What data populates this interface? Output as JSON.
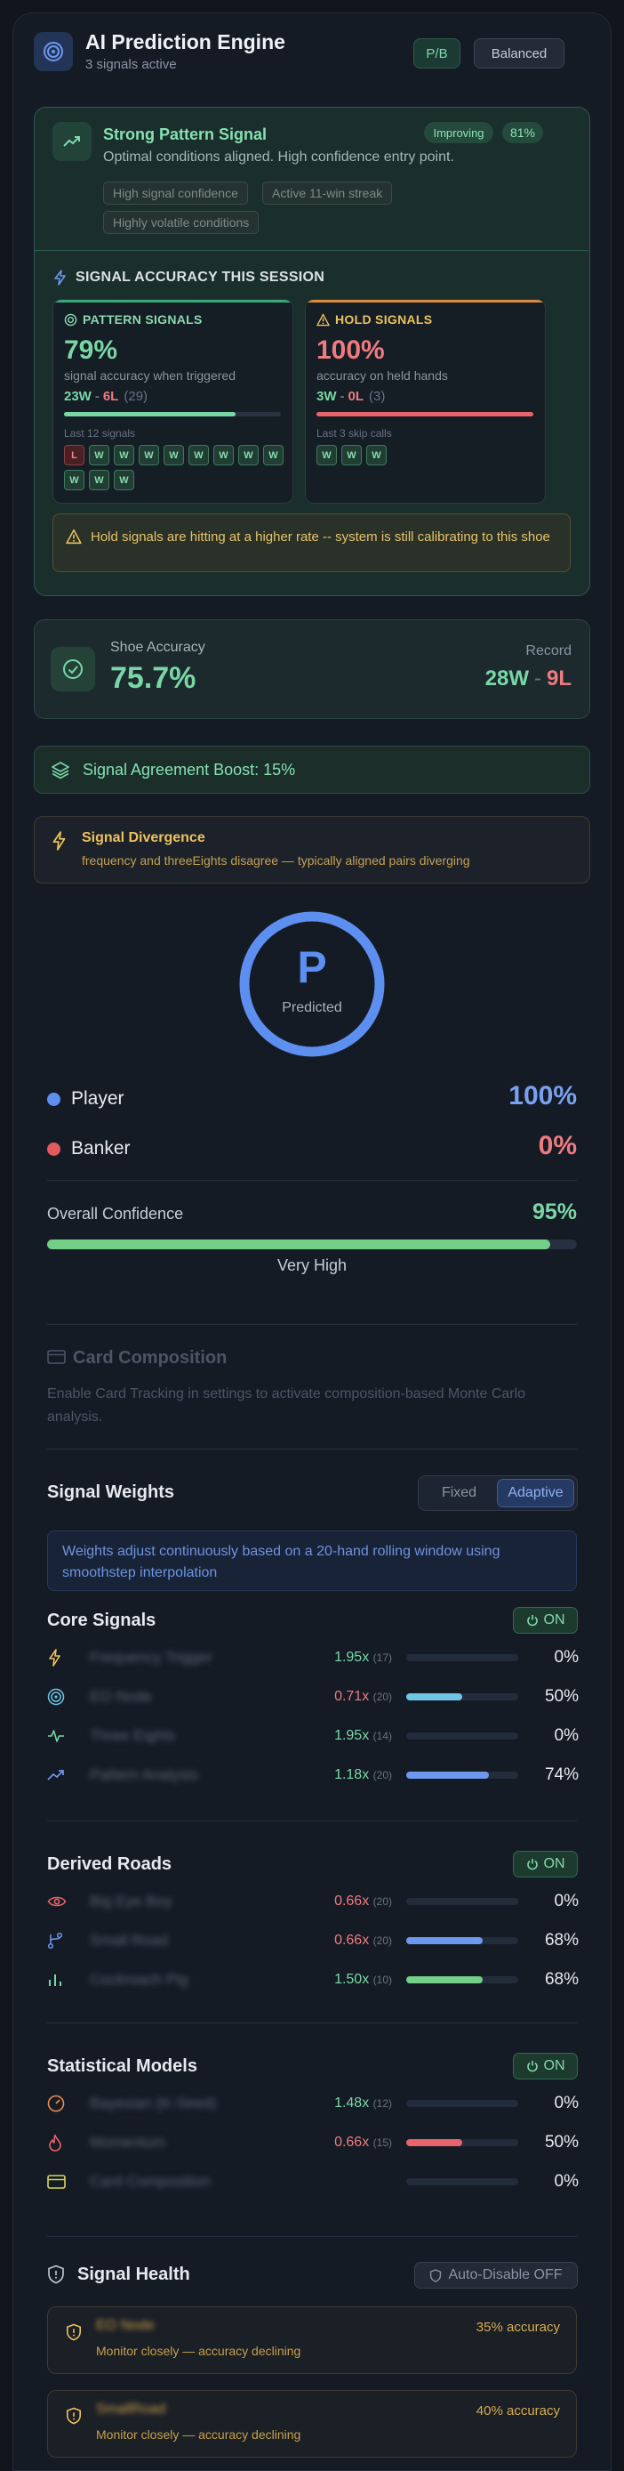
{
  "header": {
    "title": "AI Prediction Engine",
    "subtitle": "3 signals active",
    "mode_chip": "P/B",
    "profile_chip": "Balanced"
  },
  "strong_pattern": {
    "title": "Strong Pattern Signal",
    "description": "Optimal conditions aligned. High confidence entry point.",
    "trend_badge": "Improving",
    "confidence_badge": "81%",
    "tags": [
      "High signal confidence",
      "Active 11-win streak",
      "Highly volatile conditions"
    ]
  },
  "accuracy_session": {
    "heading": "SIGNAL ACCURACY THIS SESSION",
    "pattern": {
      "label": "PATTERN SIGNALS",
      "value": "79%",
      "caption": "signal accuracy when triggered",
      "wins": "23W",
      "sep": "-",
      "losses": "6L",
      "total": "(29)",
      "fill_fraction": 0.79,
      "last_label": "Last 12 signals",
      "history": [
        "L",
        "W",
        "W",
        "W",
        "W",
        "W",
        "W",
        "W",
        "W",
        "W",
        "W",
        "W"
      ]
    },
    "hold": {
      "label": "HOLD SIGNALS",
      "value": "100%",
      "caption": "accuracy on held hands",
      "wins": "3W",
      "sep": "-",
      "losses": "0L",
      "total": "(3)",
      "fill_fraction": 1.0,
      "last_label": "Last 3 skip calls",
      "history": [
        "W",
        "W",
        "W"
      ]
    },
    "warning": "Hold signals are hitting at a higher rate -- system is still calibrating to this shoe"
  },
  "shoe": {
    "label": "Shoe Accuracy",
    "value": "75.7%",
    "record_label": "Record",
    "record_wins": "28W",
    "record_sep": "-",
    "record_losses": "9L"
  },
  "boost": {
    "text": "Signal Agreement Boost: 15%"
  },
  "divergence": {
    "title": "Signal Divergence",
    "description": "frequency and threeEights disagree — typically aligned pairs diverging"
  },
  "prediction": {
    "letter": "P",
    "label": "Predicted",
    "player_label": "Player",
    "player_pct": "100%",
    "banker_label": "Banker",
    "banker_pct": "0%",
    "confidence_label": "Overall Confidence",
    "confidence_value": "95%",
    "confidence_fraction": 0.95,
    "confidence_text": "Very High"
  },
  "card_composition": {
    "title": "Card Composition",
    "description": "Enable Card Tracking in settings to activate composition-based Monte Carlo analysis."
  },
  "weights": {
    "title": "Signal Weights",
    "modes": [
      "Fixed",
      "Adaptive"
    ],
    "active_mode": "Adaptive",
    "info": "Weights adjust continuously based on a 20-hand rolling window using smoothstep interpolation"
  },
  "groups": [
    {
      "title": "Core Signals",
      "status": "ON",
      "rows": [
        {
          "icon": "lightning-icon",
          "name": "Frequency Trigger",
          "mult": "1.95x",
          "n": "(17)",
          "tone": "green",
          "fill": 0.0,
          "pct": "0%"
        },
        {
          "icon": "target-icon",
          "name": "EO Node",
          "mult": "0.71x",
          "n": "(20)",
          "tone": "red",
          "fill": 0.5,
          "pct": "50%",
          "bar": "cyan"
        },
        {
          "icon": "pulse-icon",
          "name": "Three Eights",
          "mult": "1.95x",
          "n": "(14)",
          "tone": "green",
          "fill": 0.0,
          "pct": "0%"
        },
        {
          "icon": "trend-icon",
          "name": "Pattern Analysis",
          "mult": "1.18x",
          "n": "(20)",
          "tone": "green",
          "fill": 0.74,
          "pct": "74%",
          "bar": "blue"
        }
      ]
    },
    {
      "title": "Derived Roads",
      "status": "ON",
      "rows": [
        {
          "icon": "eye-icon",
          "name": "Big Eye Boy",
          "mult": "0.66x",
          "n": "(20)",
          "tone": "red",
          "fill": 0.0,
          "pct": "0%"
        },
        {
          "icon": "branch-icon",
          "name": "Small Road",
          "mult": "0.66x",
          "n": "(20)",
          "tone": "red",
          "fill": 0.68,
          "pct": "68%",
          "bar": "blue"
        },
        {
          "icon": "bars-icon",
          "name": "Cockroach Pig",
          "mult": "1.50x",
          "n": "(10)",
          "tone": "green",
          "fill": 0.68,
          "pct": "68%",
          "bar": "green"
        }
      ]
    },
    {
      "title": "Statistical Models",
      "status": "ON",
      "rows": [
        {
          "icon": "gauge-icon",
          "name": "Bayesian (K-Seed)",
          "mult": "1.48x",
          "n": "(12)",
          "tone": "green",
          "fill": 0.0,
          "pct": "0%"
        },
        {
          "icon": "flame-icon",
          "name": "Momentum",
          "mult": "0.66x",
          "n": "(15)",
          "tone": "red",
          "fill": 0.5,
          "pct": "50%",
          "bar": "red"
        },
        {
          "icon": "card-icon",
          "name": "Card Composition",
          "mult": "",
          "n": "",
          "tone": "green",
          "fill": 0.0,
          "pct": "0%"
        }
      ]
    }
  ],
  "health": {
    "title": "Signal Health",
    "auto_disable": "Auto-Disable OFF",
    "items": [
      {
        "name": "EO Node",
        "desc": "Monitor closely — accuracy declining",
        "acc": "35% accuracy"
      },
      {
        "name": "SmallRoad",
        "desc": "Monitor closely — accuracy declining",
        "acc": "40% accuracy"
      }
    ]
  },
  "colors": {
    "accent_blue": "#5d8ff0",
    "positive": "#79d7a6",
    "negative": "#e8636a",
    "warning": "#edc25c"
  }
}
